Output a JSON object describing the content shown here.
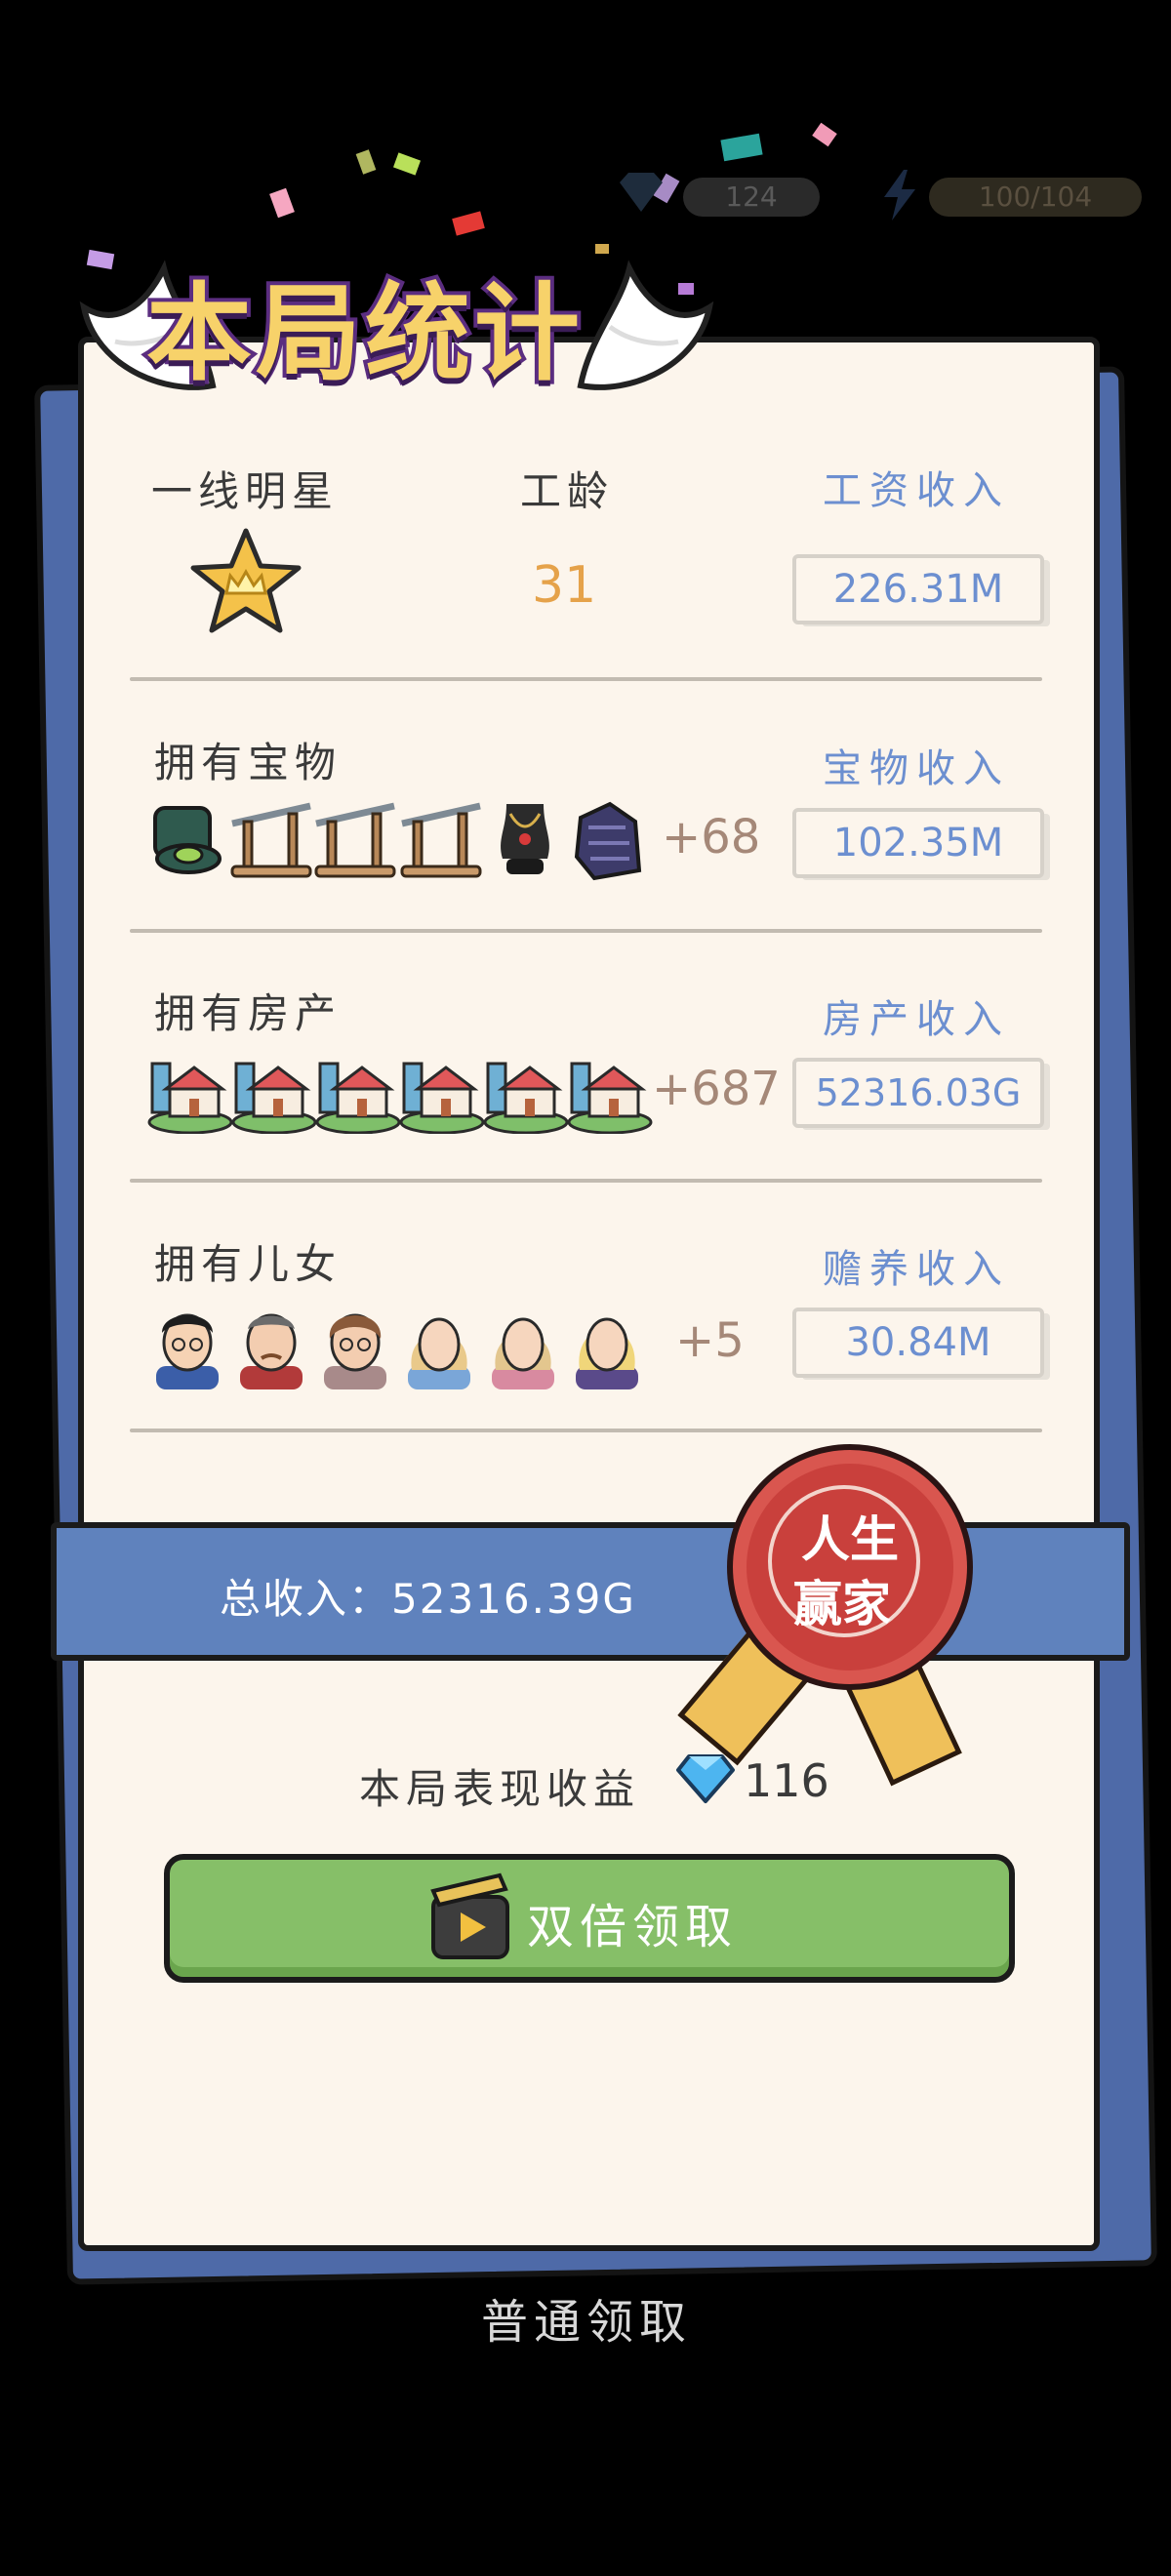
{
  "hud": {
    "gems": "124",
    "energy": "100/104"
  },
  "title": "本局统计",
  "rank": {
    "label": "一线明星",
    "seniority_label": "工龄",
    "seniority_value": "31",
    "income_label": "工资收入",
    "income_value": "226.31M"
  },
  "treasures": {
    "label": "拥有宝物",
    "more": "+68",
    "income_label": "宝物收入",
    "income_value": "102.35M"
  },
  "properties": {
    "label": "拥有房产",
    "more": "+687",
    "income_label": "房产收入",
    "income_value": "52316.03G"
  },
  "children": {
    "label": "拥有儿女",
    "more": "+5",
    "income_label": "赡养收入",
    "income_value": "30.84M"
  },
  "total": {
    "text": "总收入：52316.39G"
  },
  "seal": {
    "line1": "人生",
    "line2": "赢家"
  },
  "reward": {
    "label": "本局表现收益",
    "gems": "116"
  },
  "buttons": {
    "double": "双倍领取",
    "normal": "普通领取"
  },
  "colors": {
    "card": "#fcf5ec",
    "card_back": "#4e6aa8",
    "banner": "#5f82bd",
    "seal": "#c9403c",
    "button": "#86bf68",
    "income_text": "#6c8fd0"
  },
  "icons": [
    "gem-icon",
    "energy-icon",
    "star-crown-icon",
    "ring-box-icon",
    "sword-stand-icon",
    "necklace-icon",
    "armor-icon",
    "house-icon",
    "child-portrait-icon",
    "video-play-icon",
    "diamond-icon"
  ]
}
